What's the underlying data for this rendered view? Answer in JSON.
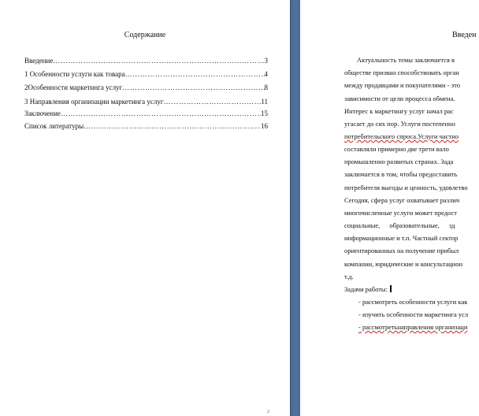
{
  "toc": {
    "title": "Содержание",
    "items": [
      {
        "label": "Введение",
        "page": "3"
      },
      {
        "label": "1 Особенности услуги как товара",
        "page": "4"
      },
      {
        "label": "2Особенности маркетинга услуг",
        "page": "8"
      },
      {
        "label": "3 Направления организации маркетинга услуг",
        "page": "11"
      },
      {
        "label": "Заключение",
        "page": "15"
      },
      {
        "label": "Список литературы",
        "page": "16"
      }
    ],
    "page_number": "2"
  },
  "intro": {
    "title": "Введен",
    "lines": [
      "Актуальность темы заключается в",
      "обществе призван способствовать орган",
      "между продавцами и покупателями - это",
      "зависимости от цели процесса обмена.",
      "Интерес к маркетингу услуг начал рас",
      "угасает до сих пор. Услуги постепенно",
      "потребительского спроса.Услуги частно",
      "составляли примерно две трети вало",
      "промышленно развитых странах. Зада",
      "заключается в том, чтобы предоставить",
      "потребителя выгоды и ценность, удовлетво",
      "Сегодня, сфера услуг охватывает различ",
      "многочисленные услуги может предост",
      "социальные, образовательные, зд",
      "информационные и т.п. Частный сектор",
      "ориентированных на получение прибыл",
      "компании, юридические и консультацион",
      "т.д.",
      "Задачи работы:",
      "- рассмотреть особенности услуги как",
      "- изучить особенности маркетинга усл",
      "- рассмотретьнаправления организаци"
    ]
  }
}
